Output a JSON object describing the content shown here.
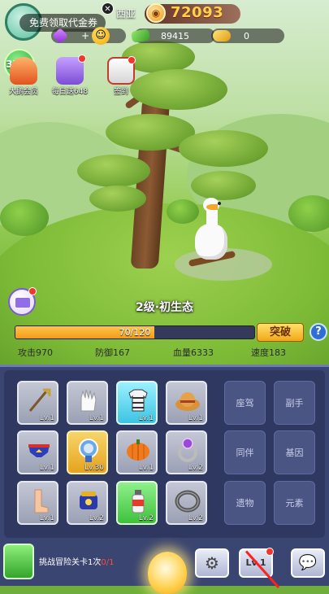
{
  "hud": {
    "coupon_text": "免费领取代金券",
    "close_glyph": "✕",
    "player_name_fragment": "西亚",
    "gold_value": "72093",
    "resources": [
      {
        "icon": "gem-icon",
        "plus": "+"
      },
      {
        "icon": "cash-icon",
        "value": "89415"
      },
      {
        "icon": "coin-icon",
        "value": "0"
      }
    ],
    "level_badge": "3733"
  },
  "activities": [
    {
      "name": "vip",
      "label": "大鹅会员",
      "icon": "vip-crown-icon"
    },
    {
      "name": "daily",
      "label": "每日送648",
      "icon": "gift-box-icon"
    },
    {
      "name": "checkin",
      "label": "签到",
      "icon": "calendar-icon"
    }
  ],
  "stage": {
    "title": "2级·初生态",
    "exp_text": "70/120",
    "exp_fraction": 0.5833,
    "breakthrough_label": "突破",
    "help_glyph": "?"
  },
  "stats": {
    "attack": "攻击970",
    "defense": "防御167",
    "hp": "血量6333",
    "speed": "速度183"
  },
  "equipment": [
    {
      "name": "trident",
      "level": "Lv.1",
      "rarity": "gray",
      "icon": "trident-icon"
    },
    {
      "name": "glove",
      "level": "Lv.1",
      "rarity": "gray",
      "icon": "glove-icon"
    },
    {
      "name": "striped-shirt",
      "level": "Lv.1",
      "rarity": "cyan",
      "icon": "shirt-icon"
    },
    {
      "name": "straw-hat",
      "level": "Lv.1",
      "rarity": "gray",
      "icon": "hat-icon"
    },
    {
      "name": "hero-briefs",
      "level": "Lv.1",
      "rarity": "gray",
      "icon": "briefs-icon"
    },
    {
      "name": "medal",
      "level": "Lv.30",
      "rarity": "gold",
      "icon": "medal-icon"
    },
    {
      "name": "pumpkin",
      "level": "Lv.1",
      "rarity": "gray",
      "icon": "pumpkin-icon"
    },
    {
      "name": "ring",
      "level": "Lv.2",
      "rarity": "gray",
      "icon": "ring-icon"
    },
    {
      "name": "foot",
      "level": "Lv.1",
      "rarity": "gray",
      "icon": "foot-icon"
    },
    {
      "name": "gauntlet",
      "level": "Lv.2",
      "rarity": "gray",
      "icon": "gauntlet-icon"
    },
    {
      "name": "spray-can",
      "level": "Lv.2",
      "rarity": "green",
      "icon": "spray-icon"
    },
    {
      "name": "iron-ring",
      "level": "Lv.2",
      "rarity": "gray",
      "icon": "iron-ring-icon"
    }
  ],
  "side_slots": [
    "座驾",
    "副手",
    "同伴",
    "基因",
    "遗物",
    "元素"
  ],
  "bottom": {
    "quest_text": "挑战冒险关卡1次",
    "quest_progress": "0/1",
    "lv_button": "Lv.1",
    "settings_glyph": "⚙",
    "chat_glyph": "💬"
  },
  "colors": {
    "panel_bg": "#3a4571",
    "exp_fill": "#f39a1c",
    "gold_text": "#ffd24a"
  }
}
